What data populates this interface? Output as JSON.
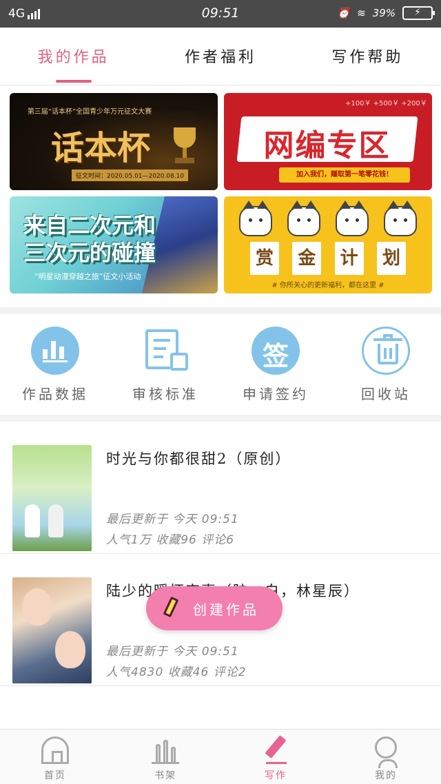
{
  "status_bar": {
    "network": "4G",
    "time": "09:51",
    "battery_percent": "39%",
    "icons": [
      "signal-icon",
      "alarm-icon",
      "wifi-icon",
      "battery-charging-icon"
    ]
  },
  "tabs": [
    {
      "label": "我的作品",
      "active": true
    },
    {
      "label": "作者福利",
      "active": false
    },
    {
      "label": "写作帮助",
      "active": false
    }
  ],
  "banners": [
    {
      "id": "huabenbei",
      "title": "话本杯",
      "subtitle": "第三届“话本杯”全国青少年万元征文大赛",
      "date": "征文时间：2020.05.01—2020.08.10"
    },
    {
      "id": "wangbian",
      "title": "网编专区",
      "top_note": "+100￥  +500￥  +200￥",
      "tagline": "加入我们，赚取第一笔零花钱！"
    },
    {
      "id": "erciyuan",
      "title_line1": "来自二次元和",
      "title_line2": "三次元的碰撞",
      "caption": "“明星动漫穿越之旅”征文小活动"
    },
    {
      "id": "shangjin",
      "cards": [
        "赏",
        "金",
        "计",
        "划"
      ],
      "footer": "# 你所关心的更新福利，都在这里 #"
    }
  ],
  "shortcuts": [
    {
      "label": "作品数据",
      "icon": "bar-chart-icon"
    },
    {
      "label": "审核标准",
      "icon": "document-review-icon"
    },
    {
      "label": "申请签约",
      "icon": "sign-icon",
      "glyph": "签"
    },
    {
      "label": "回收站",
      "icon": "trash-icon"
    }
  ],
  "works": [
    {
      "title": "时光与你都很甜2（原创）",
      "updated": "最后更新于 今天 09:51",
      "stats": "人气1万 收藏96 评论6"
    },
    {
      "title": "陆少的暖怀宠妻（陆一白，林星辰）",
      "updated": "最后更新于 今天 09:51",
      "stats": "人气4830 收藏46 评论2"
    }
  ],
  "create_button": {
    "label": "创建作品",
    "icon": "pencil-icon"
  },
  "bottom_nav": [
    {
      "label": "首页",
      "icon": "home-icon",
      "active": false
    },
    {
      "label": "书架",
      "icon": "bookshelf-icon",
      "active": false
    },
    {
      "label": "写作",
      "icon": "write-icon",
      "active": true
    },
    {
      "label": "我的",
      "icon": "profile-icon",
      "active": false
    }
  ],
  "colors": {
    "accent": "#e0607e",
    "create_button": "#f27fae",
    "icon_blue": "#83c3ea",
    "status_bar": "#4a4a4a"
  }
}
